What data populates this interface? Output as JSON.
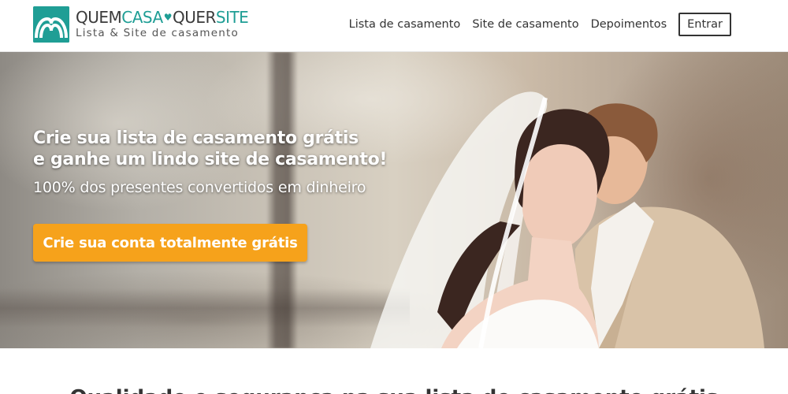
{
  "brand": {
    "name_part1": "QUEM",
    "name_part2": "CASA",
    "heart": "♥",
    "name_part3": "QUER",
    "name_part4": "SITE",
    "tagline": "Lista & Site de casamento",
    "accent_color": "#1f9e95",
    "logo_icon": "heart-logo-icon"
  },
  "nav": {
    "items": [
      {
        "label": "Lista de casamento"
      },
      {
        "label": "Site de casamento"
      },
      {
        "label": "Depoimentos"
      }
    ],
    "login_label": "Entrar"
  },
  "hero": {
    "title_line1": "Crie sua lista de casamento grátis",
    "title_line2": "e ganhe um lindo site de casamento!",
    "subtitle": "100% dos presentes convertidos em dinheiro",
    "cta_label": "Crie sua conta totalmente grátis",
    "cta_color": "#f6a21b"
  },
  "section": {
    "title_partial": "Qualidade e segurança na sua lista de casamento grátis"
  }
}
